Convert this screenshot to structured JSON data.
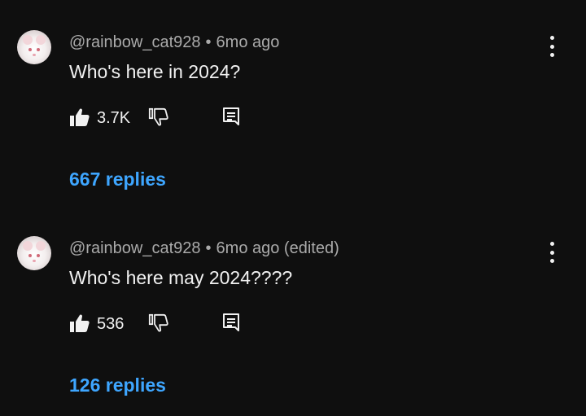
{
  "comments": [
    {
      "username": "@rainbow_cat928",
      "separator": "•",
      "time": "6mo ago",
      "text": "Who's here in 2024?",
      "likes": "3.7K",
      "replies": "667 replies"
    },
    {
      "username": "@rainbow_cat928",
      "separator": "•",
      "time": "6mo ago (edited)",
      "text": "Who's here may 2024????",
      "likes": "536",
      "replies": "126 replies"
    }
  ],
  "icons": {
    "like": "thumbs-up-icon",
    "dislike": "thumbs-down-icon",
    "reply": "reply-comment-icon",
    "menu": "more-vert-icon"
  },
  "colors": {
    "background": "#0f0f0f",
    "text": "#f1f1f1",
    "meta": "#aaaaaa",
    "replies_link": "#3ea6ff"
  }
}
